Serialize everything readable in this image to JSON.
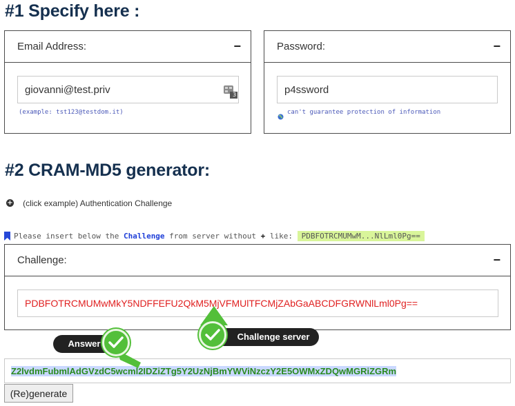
{
  "section1": {
    "heading": "#1 Specify here :",
    "email": {
      "label": "Email Address:",
      "value": "giovanni@test.priv",
      "hint": "(example: tst123@testdom.it)",
      "badge": "3"
    },
    "password": {
      "label": "Password:",
      "value": "p4ssword",
      "hint": "can't guarantee protection of information"
    },
    "collapse_symbol": "−"
  },
  "section2": {
    "heading": "#2 CRAM-MD5 generator:",
    "example_toggle": "(click example) Authentication Challenge",
    "instruction": {
      "part1": "Please insert below the ",
      "challenge_word": "Challenge",
      "part2": " from server  without ",
      "plus": "+",
      "part3": " like: ",
      "example": "PDBFOTRCMUMwM...NlLml0Pg=="
    },
    "challenge": {
      "label": "Challenge:",
      "value": "PDBFOTRCMUMwMkY5NDFFEFU2QkM5MjVFMUlTFCMjZAbGaABCDFGRWNlLml0Pg=="
    },
    "answer_value": "Z2lvdmFubmlAdGVzdC5wcml2IDZiZTg5Y2UzNjBmYWViNzczY2E5OWMxZDQwMGRiZGRm",
    "regenerate_button": "(Re)generate"
  },
  "annotations": {
    "answer_label": "Answer",
    "challenge_label": "Challenge server"
  },
  "colors": {
    "heading": "#15304f",
    "challenge_text": "#e02020",
    "answer_text": "#2a8a1e",
    "check_green": "#53bf3a",
    "example_highlight": "#d9f59a"
  }
}
